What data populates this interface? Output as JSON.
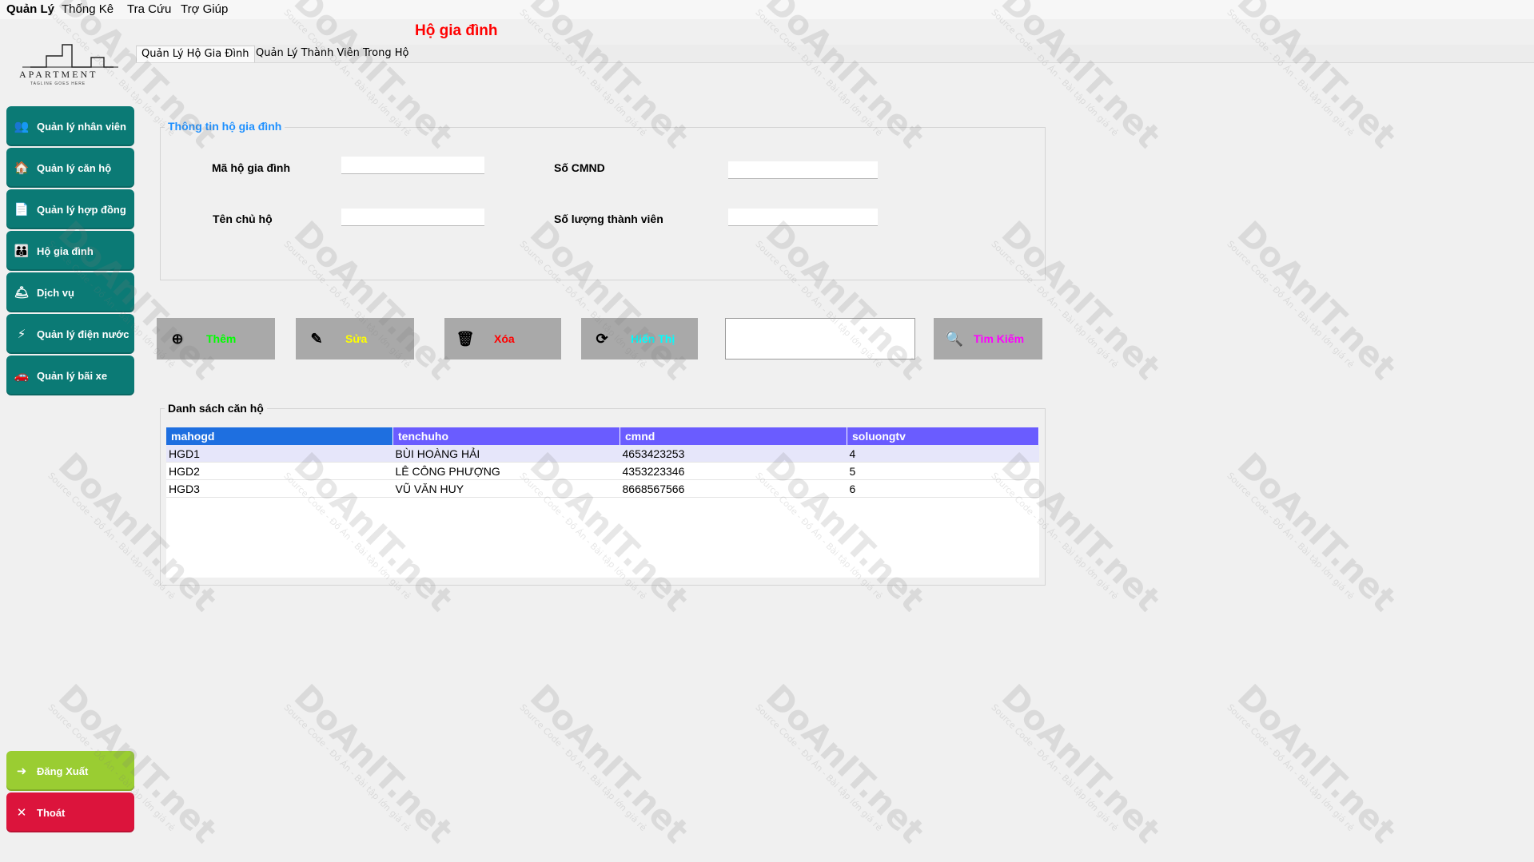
{
  "menu": [
    "Quản Lý",
    "Thống Kê",
    "Tra Cứu",
    "Trợ Giúp"
  ],
  "logo": {
    "text": "APARTMENT",
    "tagline": "TAGLINE GOES HERE"
  },
  "sidebar": {
    "items": [
      {
        "label": "Quản lý nhân viên",
        "icon": "staff-icon"
      },
      {
        "label": "Quản lý căn hộ",
        "icon": "house-icon"
      },
      {
        "label": "Quản lý hợp đồng",
        "icon": "contract-icon"
      },
      {
        "label": "Hộ gia đình",
        "icon": "family-icon"
      },
      {
        "label": "Dịch vụ",
        "icon": "service-icon"
      },
      {
        "label": "Quản lý điện nước",
        "icon": "utility-icon"
      },
      {
        "label": "Quản lý bãi xe",
        "icon": "parking-icon"
      }
    ],
    "logout_label": "Đăng Xuất",
    "exit_label": "Thoát"
  },
  "header": {
    "title": "Hộ gia đình"
  },
  "tabs": [
    "Quản Lý Hộ Gia Đình",
    "Quản Lý Thành Viên Trong Hộ"
  ],
  "info_group": {
    "legend": "Thông tin hộ gia đình",
    "ma_ho_label": "Mã hộ gia đình",
    "ten_chu_ho_label": "Tên chủ hộ",
    "cmnd_label": "Số CMND",
    "so_luong_label": "Số lượng thành viên",
    "ma_ho_value": "",
    "ten_chu_ho_value": "",
    "cmnd_value": "",
    "so_luong_value": ""
  },
  "actions": {
    "add": "Thêm",
    "edit": "Sửa",
    "delete": "Xóa",
    "show": "Hiển Thị",
    "search": "Tìm Kiếm",
    "search_value": ""
  },
  "colors": {
    "add": "#00ff00",
    "edit": "#ffff00",
    "delete": "#ff0000",
    "show": "#00ffff",
    "search": "#ff00ff"
  },
  "list_group": {
    "legend": "Danh sách căn hộ",
    "columns": [
      "mahogd",
      "tenchuho",
      "cmnd",
      "soluongtv"
    ],
    "rows": [
      [
        "HGD1",
        "BÙI HOÀNG HẢI",
        "4653423253",
        "4"
      ],
      [
        "HGD2",
        "LÊ CÔNG PHƯỢNG",
        "4353223346",
        "5"
      ],
      [
        "HGD3",
        "VŨ VĂN HUY",
        "8668567566",
        "6"
      ]
    ]
  },
  "watermark": {
    "main": "DoAnIT.net",
    "sub": "Source Code - Đồ Án - Bài tập lớn giá rẻ"
  }
}
